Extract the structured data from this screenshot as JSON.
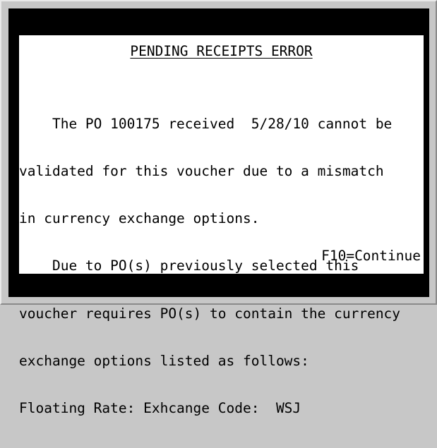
{
  "dialog": {
    "title": "PENDING RECEIPTS ERROR",
    "message_lines": [
      "    The PO 100175 received  5/28/10 cannot be",
      "validated for this voucher due to a mismatch",
      "in currency exchange options.",
      "    Due to PO(s) previously selected this",
      "voucher requires PO(s) to contain the currency",
      "exchange options listed as follows:",
      "Floating Rate: Exhcange Code:  WSJ"
    ],
    "continue_label": "F10=Continue"
  },
  "colors": {
    "background": "#c7c7c7",
    "terminal": "#000000",
    "dialog": "#ffffff",
    "text": "#000000"
  }
}
